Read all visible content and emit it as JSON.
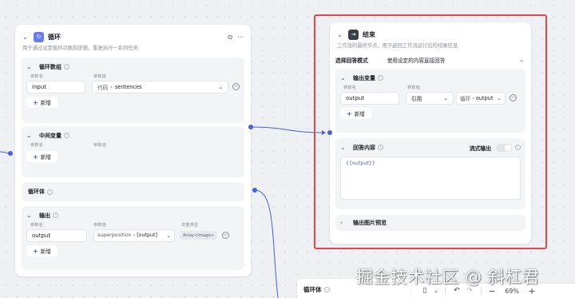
{
  "loop_node": {
    "title": "循环",
    "desc": "用于通过设定循环次数和逻辑，重复执行一系列任务",
    "loop_array": {
      "title": "循环数组",
      "col_name": "参数名",
      "col_value": "参数值",
      "param": "input",
      "source": "代码",
      "field": "sentences",
      "add_label": "新增"
    },
    "mid_var": {
      "title": "中间变量",
      "col_name": "参数名",
      "col_value": "参数值",
      "add_label": "新增"
    },
    "loop_body": {
      "title": "循环体"
    },
    "output": {
      "title": "输出",
      "col_name": "参数名",
      "col_value": "参数值",
      "col_type": "变量类型",
      "param": "output",
      "source": "superposition",
      "field": "[output]",
      "type_tag": "Array<Image>",
      "add_label": "新增"
    }
  },
  "end_node": {
    "title": "结束",
    "desc": "工作流的最终节点，用于返回工作流运行后的结果信息",
    "mode_label": "选择回答模式",
    "mode_value": "使用设定的内容直接回答",
    "output_var": {
      "title": "输出变量",
      "col_name": "参数名",
      "col_value": "参数值",
      "param": "output",
      "ref": "引用",
      "source": "循环",
      "field": "output",
      "add_label": "新增"
    },
    "answer": {
      "title": "回答内容",
      "stream_label": "流式输出",
      "content": "{{output}}"
    },
    "image_preview": {
      "title": "输出图片预览"
    }
  },
  "bottom_node": {
    "title": "循环体"
  },
  "toolbar": {
    "zoom": "69%",
    "minus": "−",
    "plus": "+"
  },
  "watermark": "掘金技术社区 @ 斜杠君",
  "colors": {
    "accent": "#4c5fd5",
    "end_icon": "#3a3f4b",
    "highlight": "#e0464a"
  }
}
